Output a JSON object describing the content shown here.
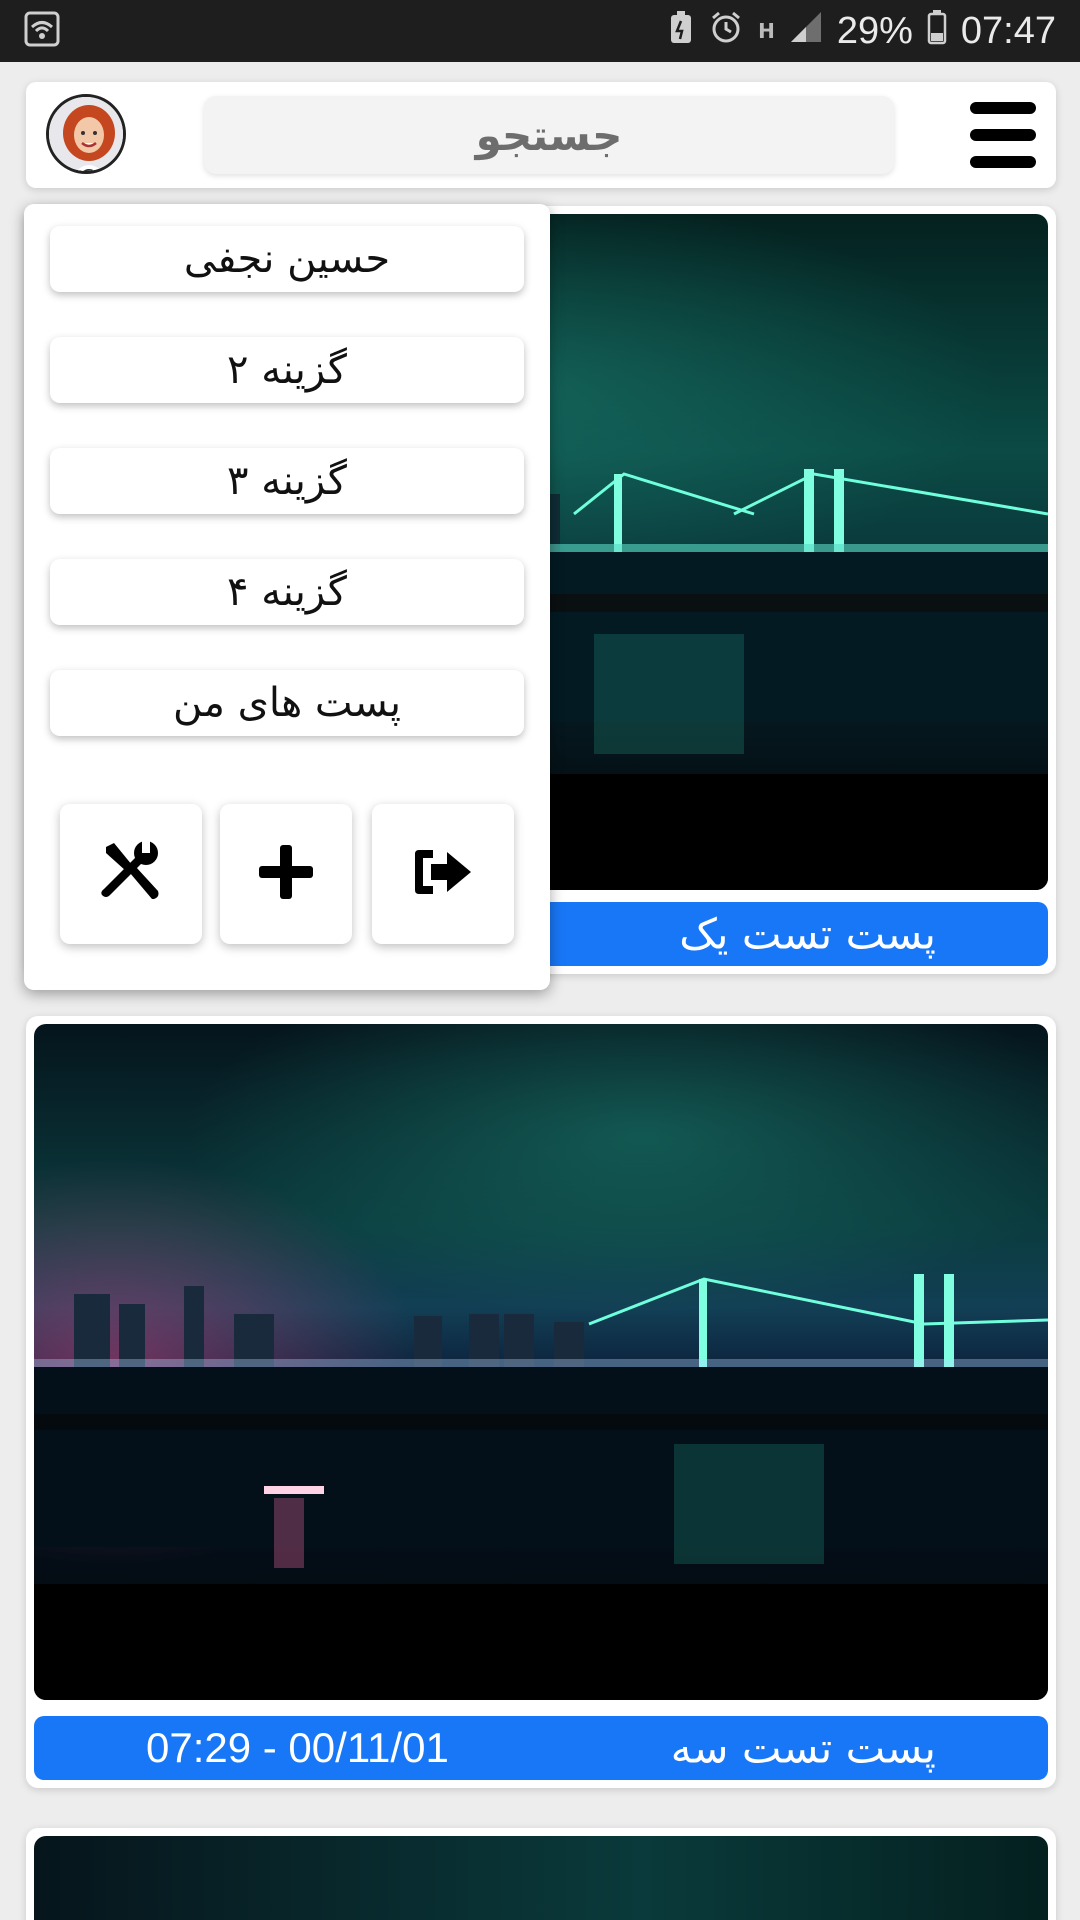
{
  "status_bar": {
    "battery_percent": "29%",
    "time": "07:47",
    "network_label": "H"
  },
  "header": {
    "search_placeholder": "جستجو"
  },
  "side_menu": {
    "items": [
      {
        "label": "حسین نجفی"
      },
      {
        "label": "گزینه ۲"
      },
      {
        "label": "گزینه ۳"
      },
      {
        "label": "گزینه ۴"
      },
      {
        "label": "پست های من"
      }
    ],
    "actions": [
      {
        "icon": "tools-icon"
      },
      {
        "icon": "plus-icon"
      },
      {
        "icon": "logout-icon"
      }
    ]
  },
  "posts": [
    {
      "title": "پست تست یک",
      "datetime": ""
    },
    {
      "title": "پست تست سه",
      "datetime": "07:29 - 00/11/01"
    }
  ],
  "colors": {
    "accent": "#1877f7",
    "status_bar": "#1e1e1e"
  }
}
